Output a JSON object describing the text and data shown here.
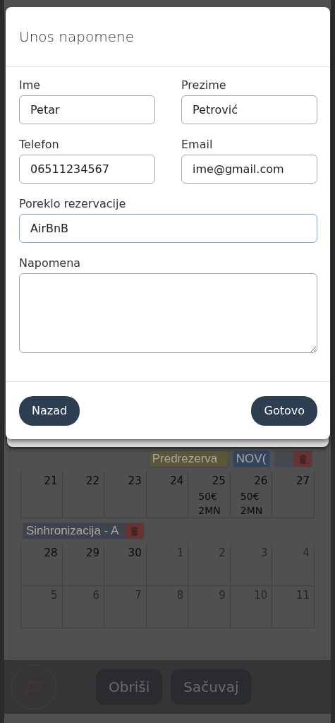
{
  "modal": {
    "title": "Unos napomene",
    "fields": [
      {
        "label": "Ime",
        "value": "Petar",
        "focused": false,
        "wide": false
      },
      {
        "label": "Prezime",
        "value": "Petrović",
        "focused": false,
        "wide": false
      },
      {
        "label": "Telefon",
        "value": "06511234567",
        "focused": false,
        "wide": false
      },
      {
        "label": "Email",
        "value": "ime@gmail.com",
        "focused": false,
        "wide": false
      },
      {
        "label": "Poreklo rezervacije",
        "value": "AirBnB",
        "focused": true,
        "wide": true
      }
    ],
    "note": {
      "label": "Napomena"
    },
    "buttons": [
      "Nazad",
      "Gotovo"
    ]
  },
  "calendar": {
    "rows": [
      {
        "kind": "events",
        "events": [
          {
            "label": "Predrezerva",
            "color": "#5a5636",
            "deletable": false
          },
          {
            "label": "NOV(",
            "color": "#34445a",
            "deletable": false
          },
          {
            "color": "#45484c",
            "deletable": true
          }
        ]
      },
      {
        "kind": "week",
        "days": [
          {
            "number": "21",
            "other_month": false
          },
          {
            "number": "22",
            "other_month": false
          },
          {
            "number": "23",
            "other_month": false
          },
          {
            "number": "24",
            "other_month": false
          },
          {
            "number": "25",
            "other_month": false,
            "price": "50€",
            "stay": "2MN"
          },
          {
            "number": "26",
            "other_month": false,
            "price": "50€",
            "stay": "2MN"
          },
          {
            "number": "27",
            "other_month": false
          }
        ]
      },
      {
        "kind": "events",
        "events": [
          {
            "label": "Sinhronizacija - A",
            "color": "#3e444c",
            "deletable": true
          }
        ]
      },
      {
        "kind": "week",
        "days": [
          {
            "number": "28",
            "other_month": false
          },
          {
            "number": "29",
            "other_month": false
          },
          {
            "number": "30",
            "other_month": false
          },
          {
            "number": "1",
            "other_month": true
          },
          {
            "number": "2",
            "other_month": true
          },
          {
            "number": "3",
            "other_month": true
          },
          {
            "number": "4",
            "other_month": true
          }
        ]
      },
      {
        "kind": "week",
        "days": [
          {
            "number": "5",
            "other_month": true
          },
          {
            "number": "6",
            "other_month": true
          },
          {
            "number": "7",
            "other_month": true
          },
          {
            "number": "8",
            "other_month": true
          },
          {
            "number": "9",
            "other_month": true
          },
          {
            "number": "10",
            "other_month": true
          },
          {
            "number": "11",
            "other_month": true
          }
        ]
      }
    ]
  },
  "bottom_bar": {
    "buttons": [
      "Obriši",
      "Sačuvaj"
    ]
  }
}
